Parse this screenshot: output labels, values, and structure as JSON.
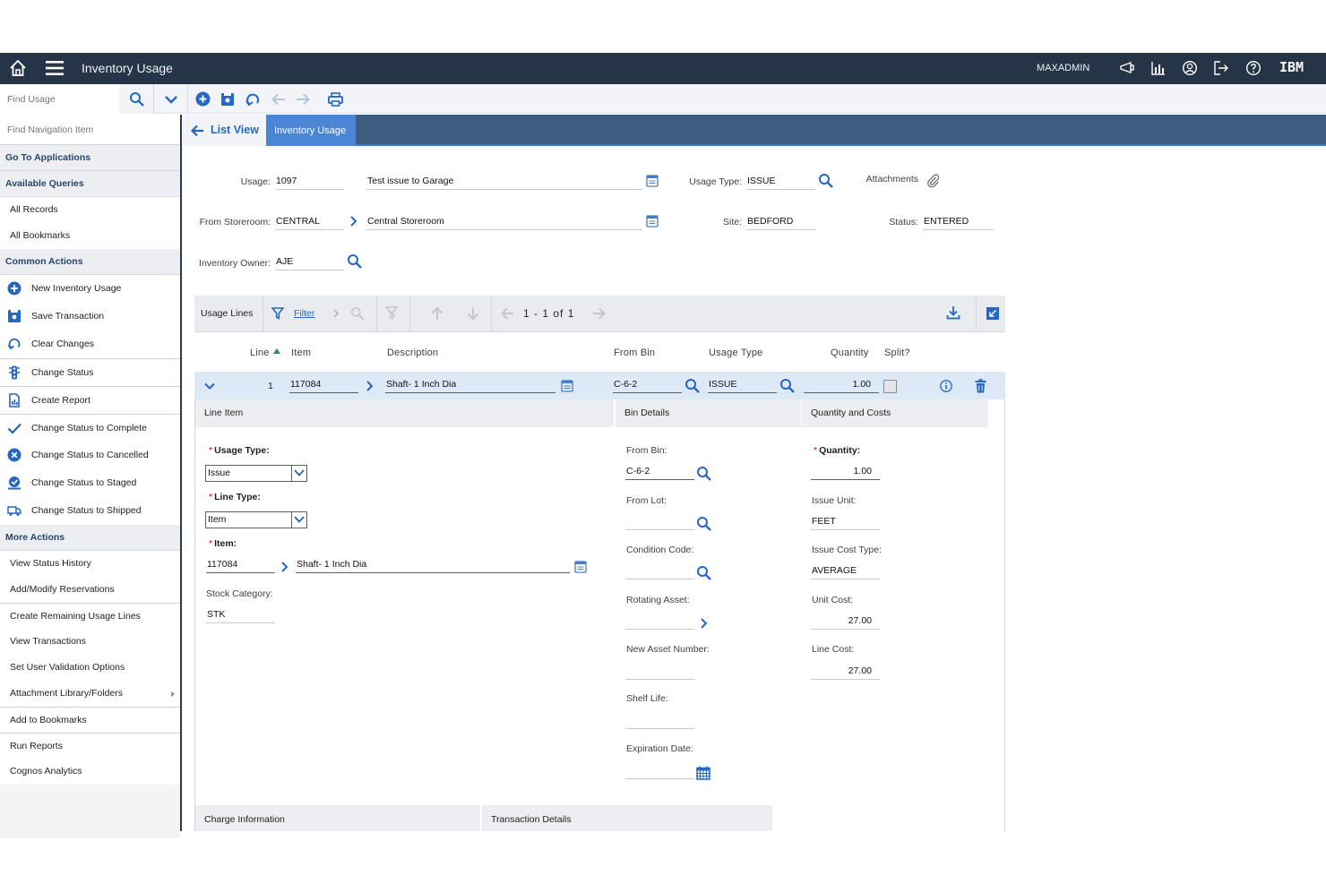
{
  "header": {
    "app_title": "Inventory Usage",
    "user": "MAXADMIN",
    "brand": "IBM"
  },
  "toolbar": {
    "find_placeholder": "Find Usage"
  },
  "sidebar": {
    "find_placeholder": "Find Navigation Item",
    "go_to": "Go To Applications",
    "available_queries": "Available Queries",
    "queries": [
      "All Records",
      "All Bookmarks"
    ],
    "common_actions": "Common Actions",
    "actions": [
      {
        "label": "New Inventory Usage",
        "icon": "plus-circle-icon"
      },
      {
        "label": "Save Transaction",
        "icon": "save-icon"
      },
      {
        "label": "Clear Changes",
        "icon": "undo-icon"
      },
      {
        "label": "Change Status",
        "icon": "traffic-light-icon"
      },
      {
        "label": "Create Report",
        "icon": "report-icon"
      },
      {
        "label": "Change Status to Complete",
        "icon": "checkmark-icon"
      },
      {
        "label": "Change Status to Cancelled",
        "icon": "cancel-circle-icon"
      },
      {
        "label": "Change Status to Staged",
        "icon": "staged-icon"
      },
      {
        "label": "Change Status to Shipped",
        "icon": "truck-icon"
      }
    ],
    "more_actions": "More Actions",
    "more": [
      "View Status History",
      "Add/Modify Reservations",
      "Create Remaining Usage Lines",
      "View Transactions",
      "Set User Validation Options",
      "Attachment Library/Folders",
      "Add to Bookmarks",
      "Run Reports",
      "Cognos Analytics"
    ]
  },
  "tabs": {
    "list_view": "List View",
    "inventory_usage": "Inventory Usage"
  },
  "form": {
    "usage_label": "Usage:",
    "usage_value": "1097",
    "usage_desc": "Test issue to Garage",
    "usage_type_label": "Usage Type:",
    "usage_type_value": "ISSUE",
    "attachments_label": "Attachments",
    "from_storeroom_label": "From Storeroom:",
    "from_storeroom_value": "CENTRAL",
    "from_storeroom_desc": "Central Storeroom",
    "site_label": "Site:",
    "site_value": "BEDFORD",
    "status_label": "Status:",
    "status_value": "ENTERED",
    "inventory_owner_label": "Inventory Owner:",
    "inventory_owner_value": "AJE"
  },
  "usage_lines": {
    "title": "Usage Lines",
    "filter": "Filter",
    "pagination": "1 - 1 of 1",
    "columns": [
      "Line",
      "Item",
      "Description",
      "From Bin",
      "Usage Type",
      "Quantity",
      "Split?"
    ],
    "row": {
      "line": "1",
      "item": "117084",
      "description": "Shaft- 1 Inch Dia",
      "from_bin": "C-6-2",
      "usage_type": "ISSUE",
      "quantity": "1.00"
    }
  },
  "line_item": {
    "title": "Line Item",
    "usage_type_label": "Usage Type:",
    "usage_type_value": "Issue",
    "line_type_label": "Line Type:",
    "line_type_value": "Item",
    "item_label": "Item:",
    "item_value": "117084",
    "item_desc": "Shaft- 1 Inch Dia",
    "stock_category_label": "Stock Category:",
    "stock_category_value": "STK"
  },
  "bin_details": {
    "title": "Bin Details",
    "from_bin_label": "From Bin:",
    "from_bin_value": "C-6-2",
    "from_lot_label": "From Lot:",
    "condition_code_label": "Condition Code:",
    "rotating_asset_label": "Rotating Asset:",
    "new_asset_label": "New Asset Number:",
    "shelf_life_label": "Shelf Life:",
    "expiration_label": "Expiration Date:"
  },
  "quantity_costs": {
    "title": "Quantity and Costs",
    "quantity_label": "Quantity:",
    "quantity_value": "1.00",
    "issue_unit_label": "Issue Unit:",
    "issue_unit_value": "FEET",
    "issue_cost_type_label": "Issue Cost Type:",
    "issue_cost_type_value": "AVERAGE",
    "unit_cost_label": "Unit Cost:",
    "unit_cost_value": "27.00",
    "line_cost_label": "Line Cost:",
    "line_cost_value": "27.00"
  },
  "bottom_sections": {
    "charge_info": "Charge Information",
    "transaction_details": "Transaction Details"
  },
  "colors": {
    "header_bg": "#253446",
    "tabbar_bg": "#3e5c80",
    "accent_blue": "#2567c1",
    "selected_row": "#dde9f6",
    "required": "#d0021b"
  }
}
